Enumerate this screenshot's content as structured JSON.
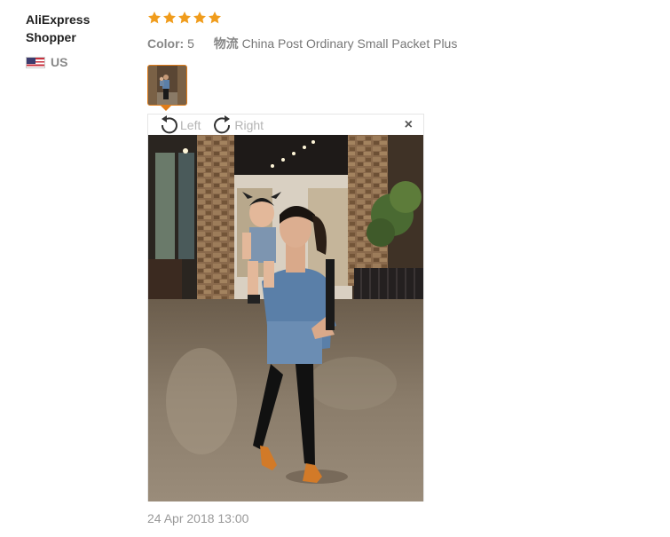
{
  "user": {
    "name_line1": "AliExpress",
    "name_line2": "Shopper",
    "country": "US"
  },
  "rating": {
    "stars": 5,
    "star_color": "#f09c1c"
  },
  "attributes": {
    "color_label": "Color:",
    "color_value": "5",
    "shipping_label": "物流",
    "shipping_value": "China Post Ordinary Small Packet Plus"
  },
  "viewer": {
    "rotate_left_label": "Left",
    "rotate_right_label": "Right",
    "close_glyph": "×"
  },
  "review_date": "24 Apr 2018 13:00",
  "colors": {
    "accent_orange": "#e07d1a",
    "muted_text": "#999999"
  }
}
